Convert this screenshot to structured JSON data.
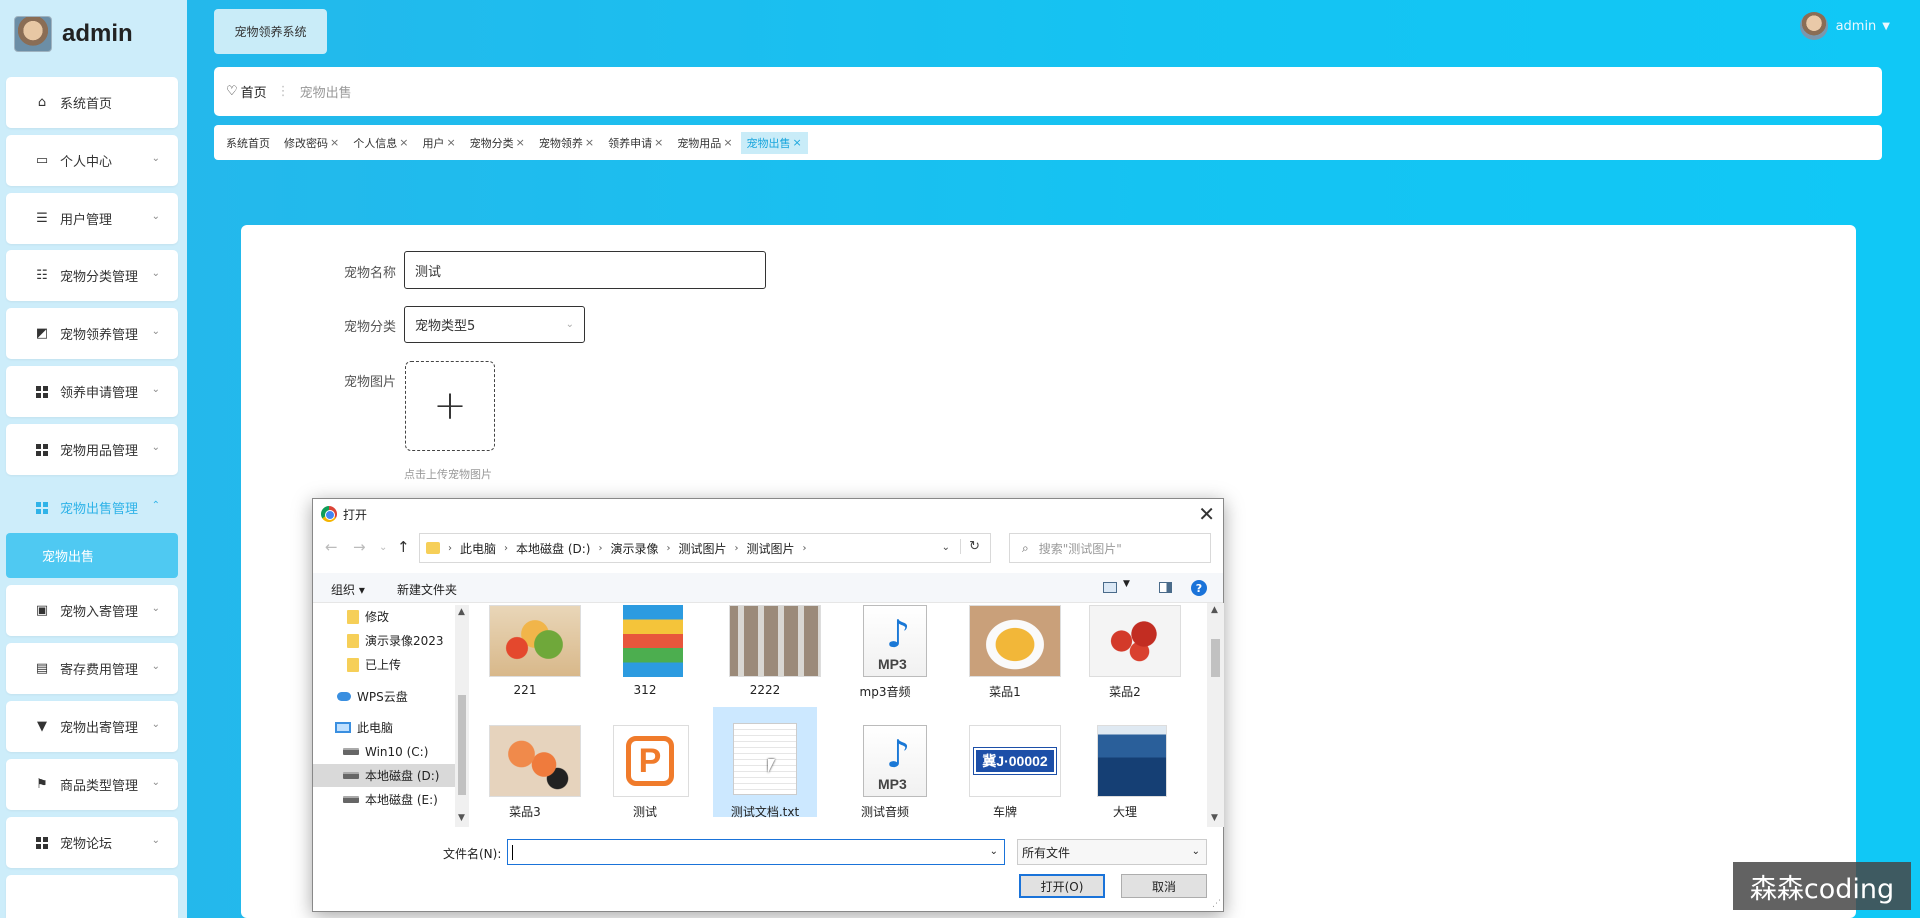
{
  "sidebar": {
    "brand": "admin",
    "items": [
      {
        "label": "系统首页",
        "icon": "home-icon"
      },
      {
        "label": "个人中心",
        "icon": "profile-icon"
      },
      {
        "label": "用户管理",
        "icon": "list-icon"
      },
      {
        "label": "宠物分类管理",
        "icon": "sliders-icon"
      },
      {
        "label": "宠物领养管理",
        "icon": "chart-icon"
      },
      {
        "label": "领养申请管理",
        "icon": "grid-icon"
      },
      {
        "label": "宠物用品管理",
        "icon": "grid-icon"
      },
      {
        "label": "宠物出售管理",
        "icon": "grid-icon"
      },
      {
        "label": "宠物入寄管理",
        "icon": "message-icon"
      },
      {
        "label": "寄存费用管理",
        "icon": "clipboard-icon"
      },
      {
        "label": "宠物出寄管理",
        "icon": "pin-icon"
      },
      {
        "label": "商品类型管理",
        "icon": "flag-icon"
      },
      {
        "label": "宠物论坛",
        "icon": "grid-icon"
      }
    ],
    "sub_item": "宠物出售",
    "accent_color": "#2fb3e8"
  },
  "header": {
    "system_button": "宠物领养系统",
    "user_name": "admin"
  },
  "breadcrumb": {
    "home": "首页",
    "current": "宠物出售"
  },
  "tags": [
    {
      "label": "系统首页",
      "closable": false
    },
    {
      "label": "修改密码",
      "closable": true
    },
    {
      "label": "个人信息",
      "closable": true
    },
    {
      "label": "用户",
      "closable": true
    },
    {
      "label": "宠物分类",
      "closable": true
    },
    {
      "label": "宠物领养",
      "closable": true
    },
    {
      "label": "领养申请",
      "closable": true
    },
    {
      "label": "宠物用品",
      "closable": true
    },
    {
      "label": "宠物出售",
      "closable": true,
      "active": true
    }
  ],
  "form": {
    "name_label": "宠物名称",
    "name_value": "测试",
    "category_label": "宠物分类",
    "category_value": "宠物类型5",
    "image_label": "宠物图片",
    "upload_hint": "点击上传宠物图片"
  },
  "dialog": {
    "title": "打开",
    "path": [
      "此电脑",
      "本地磁盘 (D:)",
      "演示录像",
      "测试图片",
      "测试图片"
    ],
    "search_placeholder": "搜索\"测试图片\"",
    "organize": "组织 ▾",
    "new_folder": "新建文件夹",
    "tree": [
      {
        "label": "修改",
        "type": "folder"
      },
      {
        "label": "演示录像2023",
        "type": "folder"
      },
      {
        "label": "已上传",
        "type": "folder"
      },
      {
        "label": "WPS云盘",
        "type": "cloud"
      },
      {
        "label": "此电脑",
        "type": "pc"
      },
      {
        "label": "Win10 (C:)",
        "type": "drive"
      },
      {
        "label": "本地磁盘 (D:)",
        "type": "drive",
        "selected": true
      },
      {
        "label": "本地磁盘 (E:)",
        "type": "drive"
      }
    ],
    "files": [
      {
        "name": "221",
        "kind": "photo-salad"
      },
      {
        "name": "312",
        "kind": "archive"
      },
      {
        "name": "2222",
        "kind": "photo-bottles"
      },
      {
        "name": "mp3音频",
        "kind": "mp3"
      },
      {
        "name": "菜品1",
        "kind": "photo-dish1"
      },
      {
        "name": "菜品2",
        "kind": "photo-dish2"
      },
      {
        "name": "菜品3",
        "kind": "photo-dish3"
      },
      {
        "name": "测试",
        "kind": "ppt"
      },
      {
        "name": "测试文档.txt",
        "kind": "txt",
        "selected": true
      },
      {
        "name": "测试音频",
        "kind": "mp3"
      },
      {
        "name": "车牌",
        "kind": "plate"
      },
      {
        "name": "大理",
        "kind": "photo-sea"
      }
    ],
    "mp3_label": "MP3",
    "plate_text": "冀J·00002",
    "filename_label": "文件名(N):",
    "filename_value": "",
    "filetype": "所有文件",
    "open_button": "打开(O)",
    "cancel_button": "取消"
  },
  "watermark": "森森coding"
}
